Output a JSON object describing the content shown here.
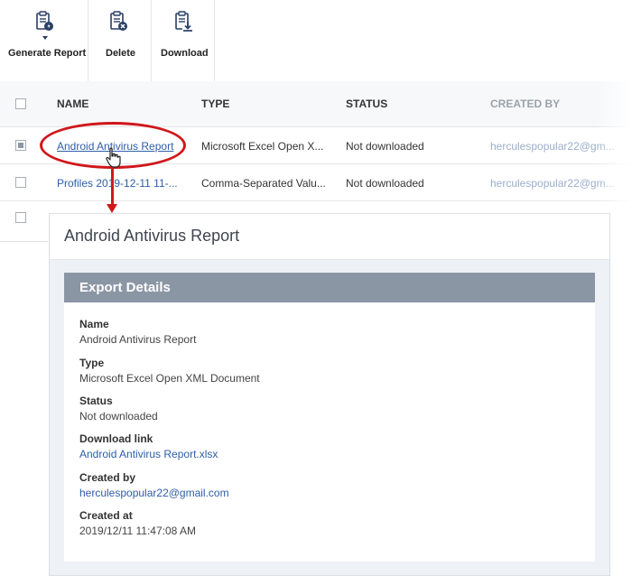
{
  "toolbar": {
    "generate_report": "Generate Report",
    "delete": "Delete",
    "download": "Download"
  },
  "table": {
    "columns": [
      "NAME",
      "TYPE",
      "STATUS",
      "CREATED BY"
    ],
    "rows": [
      {
        "name": "Android Antivirus Report",
        "type": "Microsoft Excel Open X...",
        "status": "Not downloaded",
        "created_by": "herculespopular22@gm..."
      },
      {
        "name": "Profiles 2019-12-11 11-...",
        "type": "Comma-Separated Valu...",
        "status": "Not downloaded",
        "created_by": "herculespopular22@gm..."
      }
    ]
  },
  "panel": {
    "title": "Android Antivirus Report",
    "section_title": "Export Details",
    "fields": [
      {
        "label": "Name",
        "value": "Android Antivirus Report"
      },
      {
        "label": "Type",
        "value": "Microsoft Excel Open XML Document"
      },
      {
        "label": "Status",
        "value": "Not downloaded"
      },
      {
        "label": "Download link",
        "value": "Android Antivirus Report.xlsx"
      },
      {
        "label": "Created by",
        "value": "herculespopular22@gmail.com"
      },
      {
        "label": "Created at",
        "value": "2019/12/11 11:47:08 AM"
      }
    ]
  },
  "colors": {
    "accent_red": "#d0171b",
    "link_blue": "#2e5ea8",
    "section_bar": "#8b96a5",
    "icon_navy": "#2a3f66"
  },
  "icons": [
    "generate-report-icon",
    "delete-report-icon",
    "download-report-icon",
    "hand-cursor-icon"
  ]
}
